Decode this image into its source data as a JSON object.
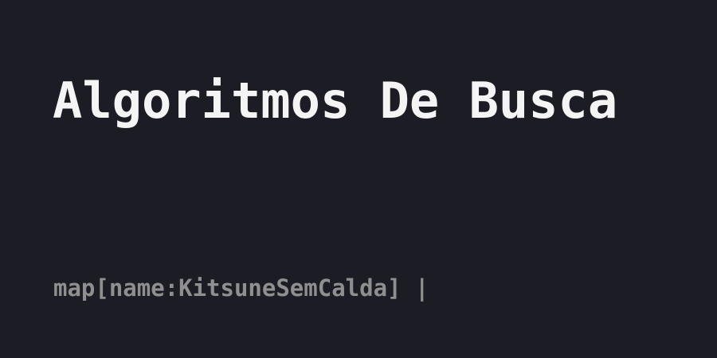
{
  "post": {
    "title": "Algoritmos De Busca",
    "meta": "map[name:KitsuneSemCalda] |"
  },
  "colors": {
    "background": "#1b1c24",
    "title": "#f4f4f4",
    "meta": "#8f8f8f"
  }
}
